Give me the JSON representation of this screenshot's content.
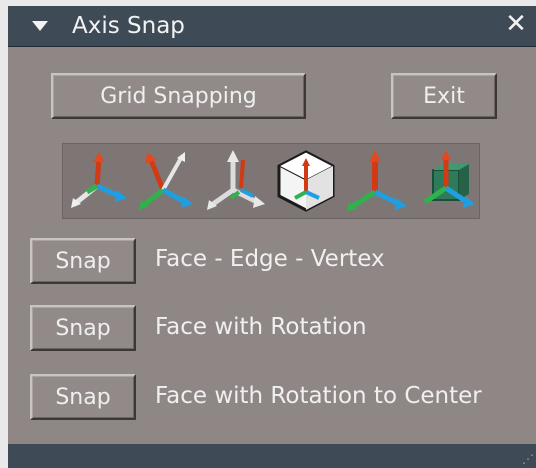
{
  "window": {
    "title": "Axis Snap",
    "close_glyph": "✕"
  },
  "buttons": {
    "grid_snapping": "Grid Snapping",
    "exit": "Exit"
  },
  "toolbar": {
    "tools": [
      {
        "icon": "axis-gizmo-icon"
      },
      {
        "icon": "axis-tilted-icon"
      },
      {
        "icon": "axis-grey-icon"
      },
      {
        "icon": "cube-axis-icon"
      },
      {
        "icon": "axis-move-icon"
      },
      {
        "icon": "axis-box-icon"
      }
    ]
  },
  "snap_rows": [
    {
      "button": "Snap",
      "label": "Face -  Edge - Vertex"
    },
    {
      "button": "Snap",
      "label": "Face with Rotation"
    },
    {
      "button": "Snap",
      "label": "Face with Rotation to Center"
    }
  ],
  "colors": {
    "titlebar": "#3f4a57",
    "panel": "#8f8785",
    "axis_red": "#d23a16",
    "axis_green": "#2fb24c",
    "axis_blue": "#1f9fe0"
  }
}
